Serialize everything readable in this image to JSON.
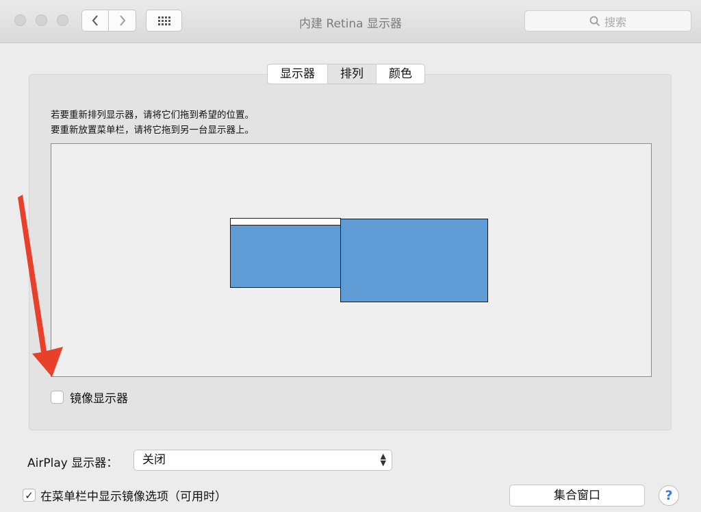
{
  "window": {
    "title": "内建 Retina 显示器",
    "search_placeholder": "搜索"
  },
  "toolbar": {
    "back_icon": "chevron-left-icon",
    "forward_icon": "chevron-right-icon",
    "grid_icon": "grid-icon"
  },
  "tabs": [
    {
      "label": "显示器",
      "active": false
    },
    {
      "label": "排列",
      "active": true
    },
    {
      "label": "颜色",
      "active": false
    }
  ],
  "arrangement": {
    "instruction_1": "若要重新排列显示器，请将它们拖到希望的位置。",
    "instruction_2": "要重新放置菜单栏，请将它拖到另一台显示器上。",
    "display_color": "#5f9bd4"
  },
  "mirror_displays": {
    "label": "镜像显示器",
    "checked": false
  },
  "airplay": {
    "label": "AirPlay 显示器：",
    "value": "关闭"
  },
  "menubar_option": {
    "label": "在菜单栏中显示镜像选项（可用时）",
    "checked": true
  },
  "gather_windows_label": "集合窗口",
  "help_label": "?",
  "annotation_color": "#e8402a"
}
